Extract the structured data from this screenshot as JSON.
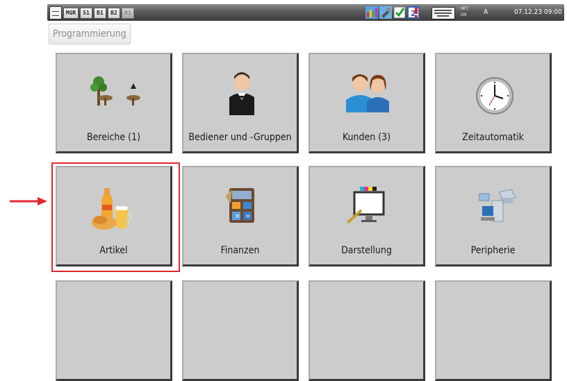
{
  "statusbar": {
    "mode_buttons": [
      "MGR",
      "S1",
      "B1",
      "B2",
      "R1"
    ],
    "net_line1": "NET",
    "net_line2": "ON",
    "user": "A",
    "datetime": "07.12.23  09:00",
    "icons": [
      "home-icon",
      "statistics-icon",
      "tools-icon",
      "checklist-icon",
      "notification-icon",
      "keyboard-icon"
    ]
  },
  "page": {
    "title": "Programmierung"
  },
  "tiles": [
    {
      "label": "Bereiche (1)",
      "icon": "areas-icon"
    },
    {
      "label": "Bediener und -Gruppen",
      "icon": "waiter-icon"
    },
    {
      "label": "Kunden (3)",
      "icon": "customers-icon"
    },
    {
      "label": "Zeitautomatik",
      "icon": "clock-icon"
    },
    {
      "label": "Artikel",
      "icon": "articles-icon"
    },
    {
      "label": "Finanzen",
      "icon": "finance-icon"
    },
    {
      "label": "Darstellung",
      "icon": "display-icon"
    },
    {
      "label": "Peripherie",
      "icon": "peripherals-icon"
    }
  ],
  "annotation": {
    "highlight_color": "#e0262e"
  },
  "colors": {
    "tile_bg": "#cccccc",
    "accent": "#e0262e"
  }
}
